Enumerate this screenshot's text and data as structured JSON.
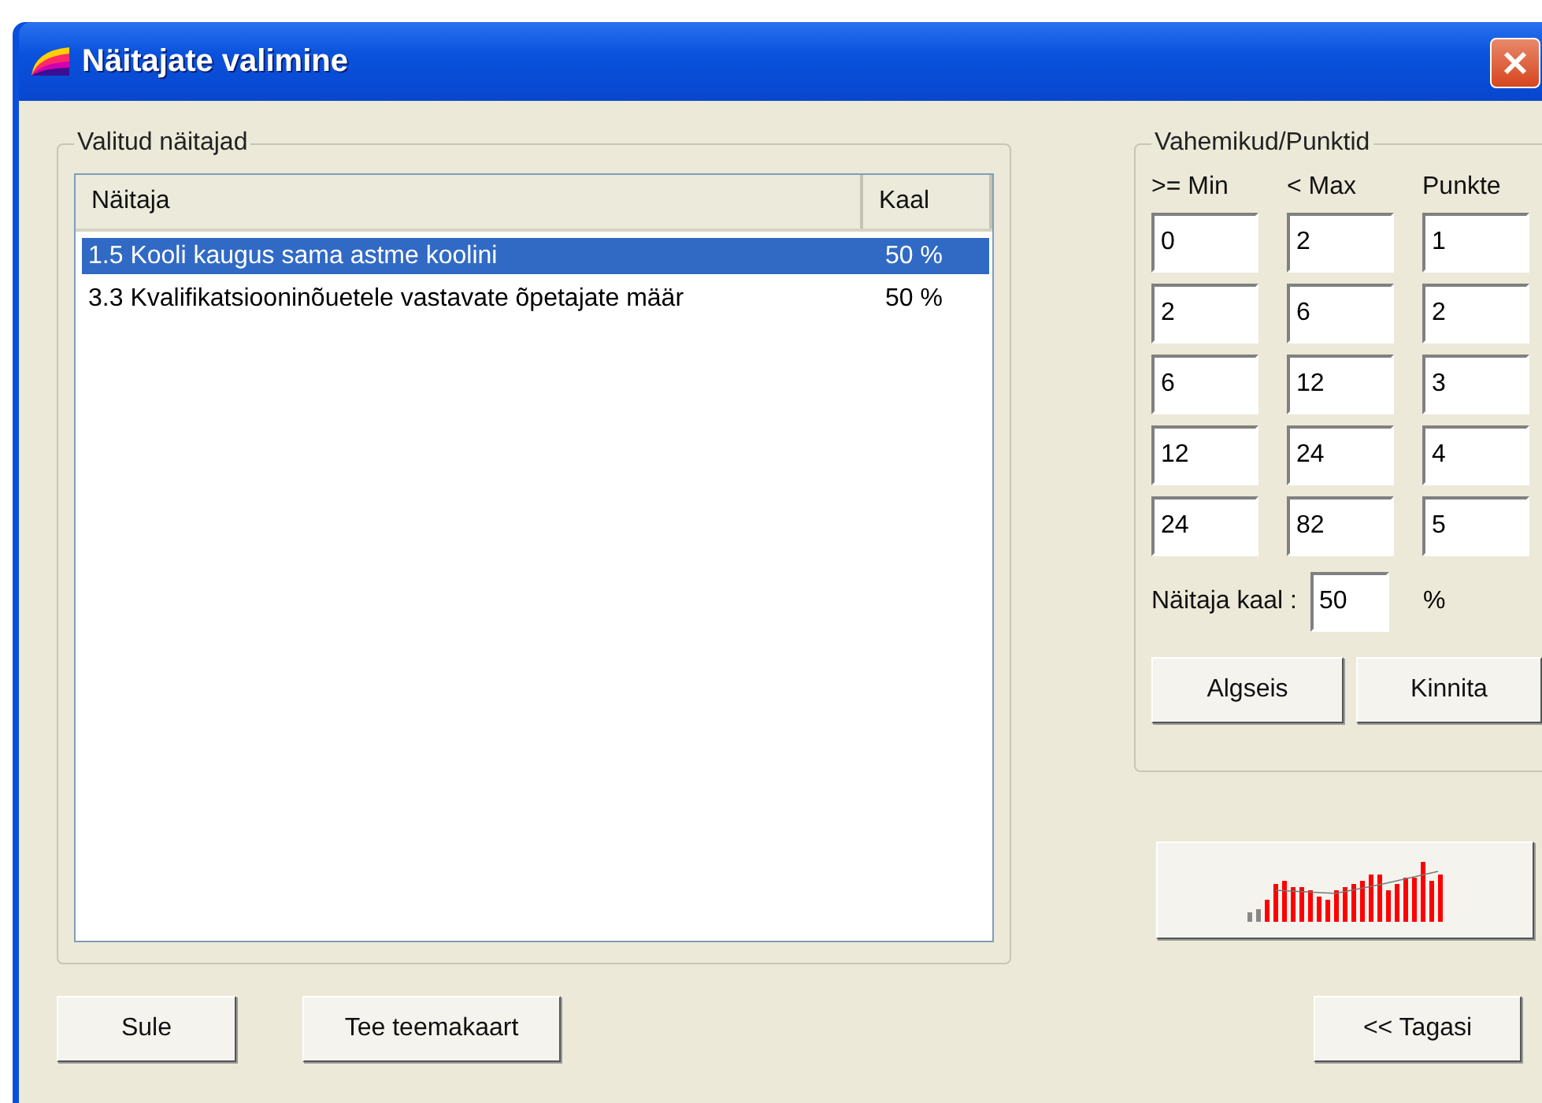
{
  "window": {
    "title": "Näitajate valimine"
  },
  "selected_indicators": {
    "title": "Valitud näitajad",
    "columns": [
      "Näitaja",
      "Kaal"
    ],
    "rows": [
      {
        "name": "1.5 Kooli kaugus sama astme koolini",
        "weight": "50 %",
        "selected": true
      },
      {
        "name": "3.3 Kvalifikatsiooninõuetele vastavate õpetajate määr",
        "weight": "50 %",
        "selected": false
      }
    ]
  },
  "ranges": {
    "title": "Vahemikud/Punktid",
    "columns": [
      ">= Min",
      "< Max",
      "Punkte"
    ],
    "rows": [
      [
        "0",
        "2",
        "1"
      ],
      [
        "2",
        "6",
        "2"
      ],
      [
        "6",
        "12",
        "3"
      ],
      [
        "12",
        "24",
        "4"
      ],
      [
        "24",
        "82",
        "5"
      ]
    ],
    "weight_label": "Näitaja kaal :",
    "weight_value": "50",
    "weight_unit": "%",
    "buttons": [
      "Algseis",
      "Kinnita"
    ]
  },
  "bottom_buttons": {
    "left": [
      "Sule",
      "Tee teemakaart"
    ],
    "right": "<< Tagasi"
  }
}
